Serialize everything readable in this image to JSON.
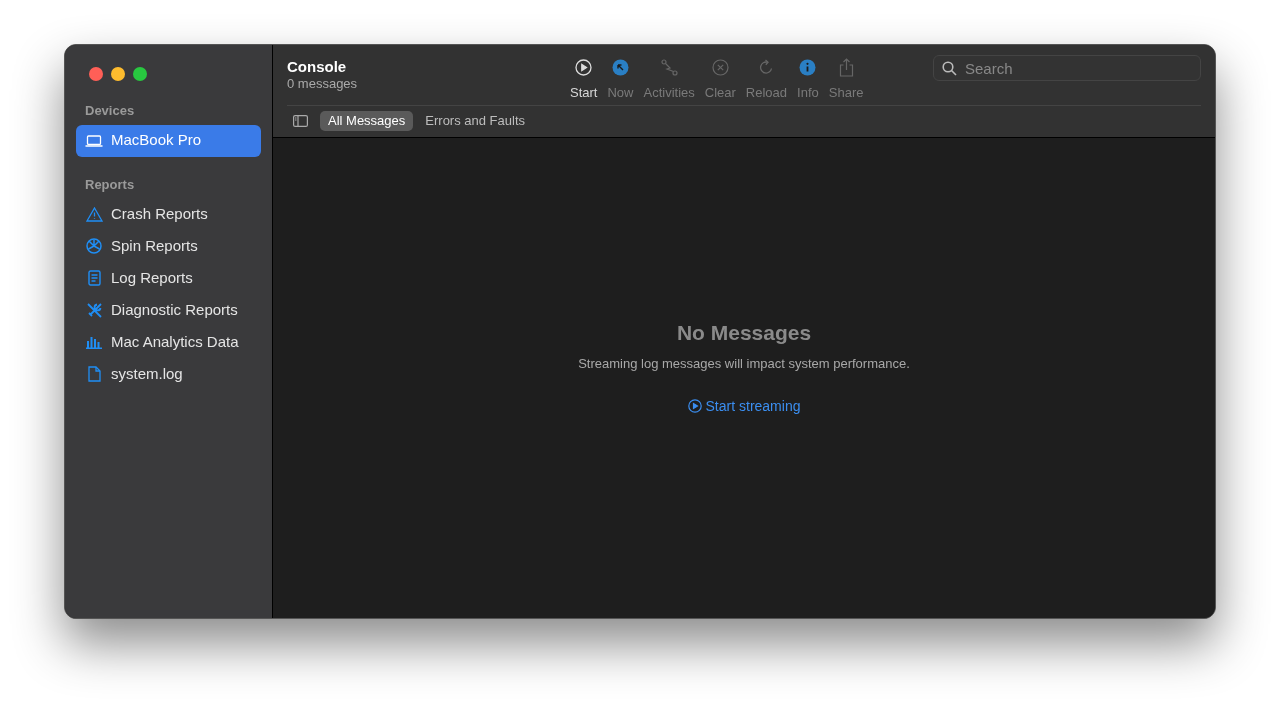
{
  "window": {
    "title": "Console",
    "subtitle": "0 messages"
  },
  "sidebar": {
    "sections": [
      {
        "heading": "Devices",
        "items": [
          {
            "label": "MacBook Pro",
            "kind": "laptop",
            "selected": true
          }
        ]
      },
      {
        "heading": "Reports",
        "items": [
          {
            "label": "Crash Reports",
            "kind": "warning",
            "selected": false
          },
          {
            "label": "Spin Reports",
            "kind": "spin",
            "selected": false
          },
          {
            "label": "Log Reports",
            "kind": "doc",
            "selected": false
          },
          {
            "label": "Diagnostic Reports",
            "kind": "tools",
            "selected": false
          },
          {
            "label": "Mac Analytics Data",
            "kind": "chart",
            "selected": false
          },
          {
            "label": "system.log",
            "kind": "file",
            "selected": false
          }
        ]
      }
    ]
  },
  "toolbar": [
    {
      "label": "Start",
      "kind": "play",
      "disabled": false
    },
    {
      "label": "Now",
      "kind": "now",
      "disabled": true
    },
    {
      "label": "Activities",
      "kind": "activities",
      "disabled": true
    },
    {
      "label": "Clear",
      "kind": "clear",
      "disabled": true
    },
    {
      "label": "Reload",
      "kind": "reload",
      "disabled": true
    },
    {
      "label": "Info",
      "kind": "info",
      "disabled": true
    },
    {
      "label": "Share",
      "kind": "share",
      "disabled": true
    }
  ],
  "search": {
    "placeholder": "Search"
  },
  "filter_tabs": [
    {
      "label": "All Messages",
      "selected": true
    },
    {
      "label": "Errors and Faults",
      "selected": false
    }
  ],
  "empty_state": {
    "title": "No Messages",
    "message": "Streaming log messages will impact system performance.",
    "action": "Start streaming"
  }
}
